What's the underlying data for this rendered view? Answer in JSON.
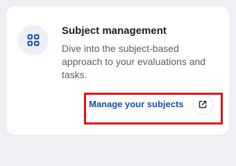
{
  "card": {
    "title": "Subject management",
    "description": "Dive into the subject-based approach to your evaluations and tasks.",
    "link_label": "Manage your subjects",
    "icon": "grid-icon",
    "action_icon": "external-link-icon"
  },
  "colors": {
    "accent": "#1a4fa3",
    "highlight": "#e0131a",
    "background": "#eff0f3",
    "card": "#ffffff"
  }
}
